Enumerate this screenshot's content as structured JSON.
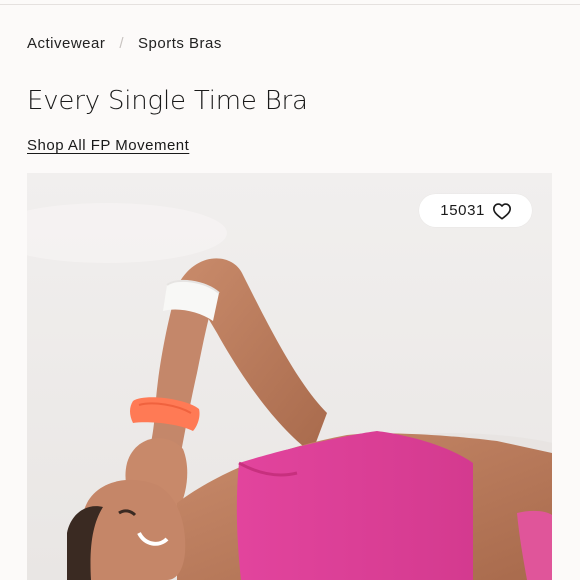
{
  "breadcrumb": {
    "items": [
      "Activewear",
      "Sports Bras"
    ],
    "separator": "/"
  },
  "product": {
    "title": "Every Single Time Bra",
    "shop_link": "Shop All FP Movement"
  },
  "image": {
    "favorites_count": "15031",
    "favorite_icon": "heart-outline-icon"
  },
  "colors": {
    "background": "#fcfaf9",
    "text": "#1a1a1a",
    "bra_pink": "#e2449d",
    "scrunchie": "#ff7a55"
  }
}
